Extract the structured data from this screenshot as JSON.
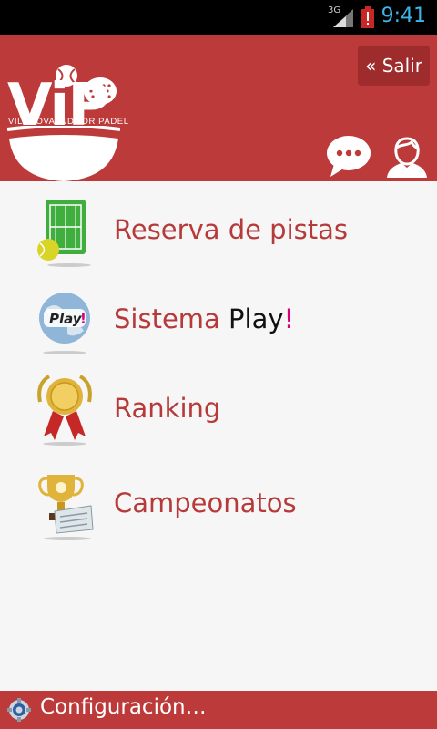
{
  "status_bar": {
    "network": "3G",
    "time": "9:41"
  },
  "header": {
    "logo_text": "ViP",
    "logo_subtitle": "VILANOVA INDOOR PADEL",
    "salir_label": "« Salir"
  },
  "menu": {
    "items": [
      {
        "label": "Reserva de pistas",
        "icon": "tennis-court-icon"
      },
      {
        "label_part1": "Sistema ",
        "label_part2": "Play",
        "label_part3": "!",
        "icon": "play-globe-icon"
      },
      {
        "label": "Ranking",
        "icon": "medal-icon"
      },
      {
        "label": "Campeonatos",
        "icon": "trophy-icon"
      }
    ]
  },
  "footer": {
    "config_label": "Configuración…"
  },
  "colors": {
    "brand_red": "#bd3a3a",
    "label_red": "#b73a3a",
    "accent_pink": "#d8007a",
    "clock_blue": "#3cb4e6"
  }
}
